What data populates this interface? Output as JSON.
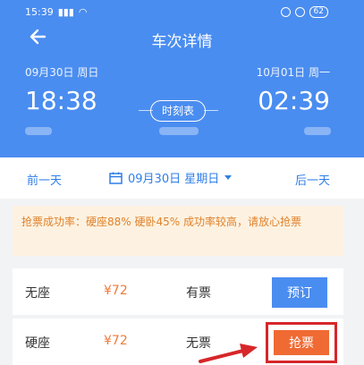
{
  "status": {
    "time": "15:39",
    "signal": "ᯤ",
    "battery": "62"
  },
  "header": {
    "title": "车次详情",
    "depart_date": "09月30日 周日",
    "arrive_date": "10月01日 周一",
    "depart_time": "18:38",
    "arrive_time": "02:39",
    "timetable_label": "时刻表"
  },
  "daybar": {
    "prev": "前一天",
    "current": "09月30日 星期日",
    "next": "后一天"
  },
  "notice": "抢票成功率：硬座88% 硬卧45% 成功率较高，请放心抢票",
  "seats": [
    {
      "name": "无座",
      "price": "¥72",
      "status": "有票",
      "action": "预订"
    },
    {
      "name": "硬座",
      "price": "¥72",
      "status": "无票",
      "action": "抢票"
    }
  ],
  "colors": {
    "primary": "#4a8df0",
    "accent": "#f06a33",
    "highlight": "#d6262a"
  }
}
